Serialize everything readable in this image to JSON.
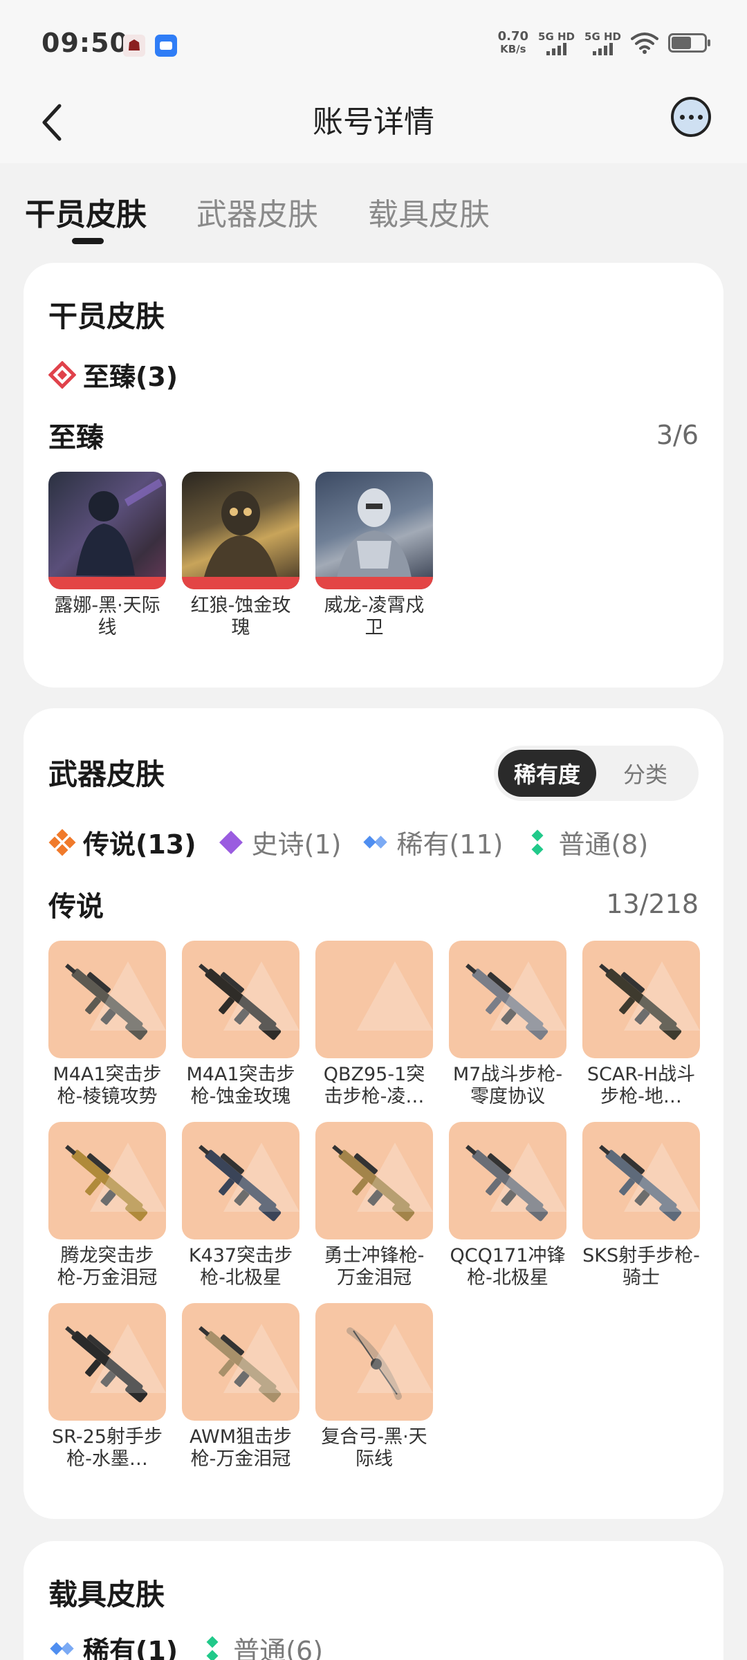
{
  "status": {
    "time": "09:50",
    "net_speed_value": "0.70",
    "net_speed_unit": "KB/s",
    "sim1": "5G HD",
    "sim2": "5G HD",
    "battery_level": 0.55
  },
  "nav": {
    "title": "账号详情"
  },
  "tabs": [
    {
      "label": "干员皮肤",
      "active": true
    },
    {
      "label": "武器皮肤",
      "active": false
    },
    {
      "label": "载具皮肤",
      "active": false
    }
  ],
  "operator": {
    "title": "干员皮肤",
    "filter": {
      "label": "至臻(3)",
      "color": "#e0424b"
    },
    "section": {
      "name": "至臻",
      "count": "3/6"
    },
    "items": [
      {
        "name": "露娜-黑·天际线"
      },
      {
        "name": "红狼-蚀金玫瑰"
      },
      {
        "name": "威龙-凌霄戍卫"
      }
    ]
  },
  "weapon": {
    "title": "武器皮肤",
    "segment": [
      {
        "label": "稀有度",
        "active": true
      },
      {
        "label": "分类",
        "active": false
      }
    ],
    "filters": [
      {
        "label": "传说(13)",
        "color": "#f07a2b",
        "active": true
      },
      {
        "label": "史诗(1)",
        "color": "#9a5ce0",
        "active": false
      },
      {
        "label": "稀有(11)",
        "color": "#4f8ef0",
        "active": false
      },
      {
        "label": "普通(8)",
        "color": "#21c98a",
        "active": false
      }
    ],
    "section": {
      "name": "传说",
      "count": "13/218"
    },
    "items": [
      {
        "name": "M4A1突击步枪-棱镜攻势"
      },
      {
        "name": "M4A1突击步枪-蚀金玫瑰"
      },
      {
        "name": "QBZ95-1突击步枪-凌…"
      },
      {
        "name": "M7战斗步枪-零度协议"
      },
      {
        "name": "SCAR-H战斗步枪-地…"
      },
      {
        "name": "腾龙突击步枪-万金泪冠"
      },
      {
        "name": "K437突击步枪-北极星"
      },
      {
        "name": "勇士冲锋枪-万金泪冠"
      },
      {
        "name": "QCQ171冲锋枪-北极星"
      },
      {
        "name": "SKS射手步枪-骑士"
      },
      {
        "name": "SR-25射手步枪-水墨…"
      },
      {
        "name": "AWM狙击步枪-万金泪冠"
      },
      {
        "name": "复合弓-黑·天际线"
      }
    ]
  },
  "vehicle": {
    "title": "载具皮肤",
    "filters": [
      {
        "label": "稀有(1)",
        "color": "#4f8ef0",
        "active": true
      },
      {
        "label": "普通(6)",
        "color": "#21c98a",
        "active": false
      }
    ]
  }
}
